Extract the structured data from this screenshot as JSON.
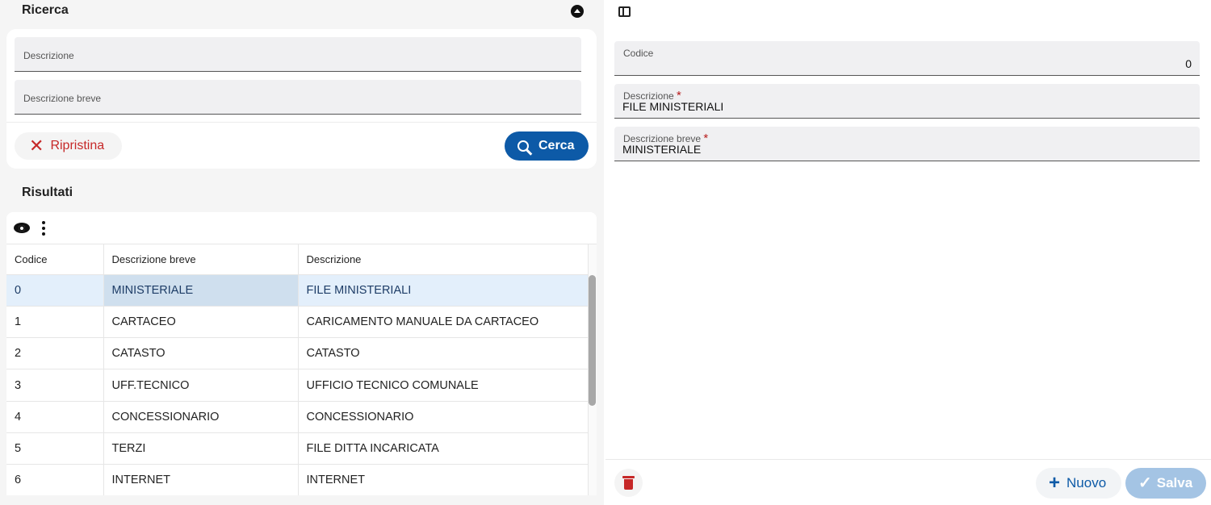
{
  "search": {
    "title": "Ricerca",
    "fields": {
      "descrizione_label": "Descrizione",
      "descrizione_breve_label": "Descrizione breve"
    },
    "reset_label": "Ripristina",
    "search_label": "Cerca"
  },
  "results": {
    "title": "Risultati",
    "columns": [
      "Codice",
      "Descrizione breve",
      "Descrizione"
    ],
    "rows": [
      {
        "codice": "0",
        "breve": "MINISTERIALE",
        "descrizione": "FILE MINISTERIALI",
        "selected": true
      },
      {
        "codice": "1",
        "breve": "CARTACEO",
        "descrizione": "CARICAMENTO MANUALE DA CARTACEO"
      },
      {
        "codice": "2",
        "breve": "CATASTO",
        "descrizione": "CATASTO"
      },
      {
        "codice": "3",
        "breve": "UFF.TECNICO",
        "descrizione": "UFFICIO TECNICO COMUNALE"
      },
      {
        "codice": "4",
        "breve": "CONCESSIONARIO",
        "descrizione": "CONCESSIONARIO"
      },
      {
        "codice": "5",
        "breve": "TERZI",
        "descrizione": "FILE DITTA INCARICATA"
      },
      {
        "codice": "6",
        "breve": "INTERNET",
        "descrizione": "INTERNET"
      }
    ]
  },
  "detail": {
    "codice_label": "Codice",
    "codice_value": "0",
    "descrizione_label": "Descrizione",
    "descrizione_value": "FILE MINISTERIALI",
    "breve_label": "Descrizione breve",
    "breve_value": "MINISTERIALE",
    "required_mark": "*",
    "new_label": "Nuovo",
    "save_label": "Salva"
  },
  "colors": {
    "primary": "#0d5aa7",
    "danger": "#c62828",
    "selected_row": "#e3effb",
    "save_disabled": "#a4c4e4"
  },
  "icons": [
    "collapse-icon",
    "close-icon",
    "search-icon",
    "eye-icon",
    "more-vert-icon",
    "side-panel-icon",
    "delete-icon",
    "plus-icon",
    "check-icon"
  ]
}
